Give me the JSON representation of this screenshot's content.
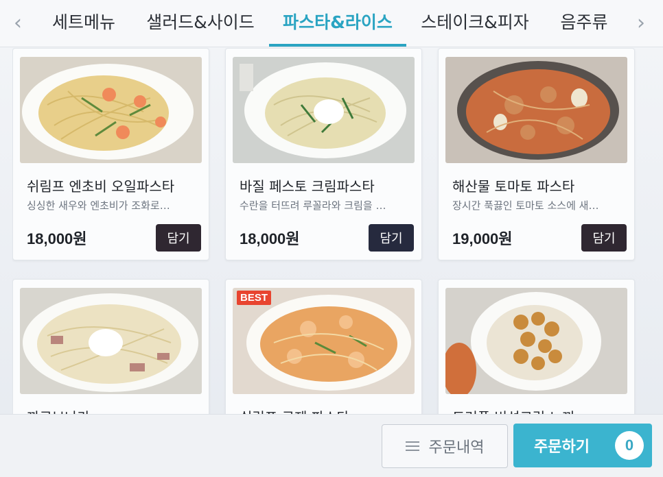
{
  "nav": {
    "prev_icon": "chevron-left-icon",
    "next_icon": "chevron-right-icon",
    "tabs": [
      {
        "label": "세트메뉴"
      },
      {
        "label": "샐러드&사이드"
      },
      {
        "label": "파스타&라이스"
      },
      {
        "label": "스테이크&피자"
      },
      {
        "label": "음주류"
      }
    ],
    "active_tab": "파스타&라이스"
  },
  "menu": {
    "add_label": "담기",
    "items": [
      {
        "name": "쉬림프 엔초비 오일파스타",
        "desc": "싱싱한 새우와 엔초비가 조화로…",
        "price": "18,000원"
      },
      {
        "name": "바질 페스토 크림파스타",
        "desc": "수란을 터뜨려 루꼴라와 크림을 …",
        "price": "18,000원"
      },
      {
        "name": "해산물 토마토 파스타",
        "desc": "장시간 푹끓인 토마토 소스에 새…",
        "price": "19,000원"
      },
      {
        "name": "까르보나라",
        "desc": "",
        "price": "",
        "badge": ""
      },
      {
        "name": "쉬림프 로제 파스타",
        "desc": "",
        "price": "",
        "badge": "BEST"
      },
      {
        "name": "트러플 버섯크림 뇨끼",
        "desc": "",
        "price": "",
        "badge": ""
      }
    ]
  },
  "footer": {
    "history_label": "주문내역",
    "order_label": "주문하기",
    "cart_count": "0"
  },
  "colors": {
    "accent": "#2aa4c2",
    "order_button": "#3bb4cf",
    "add_button": "#2f2731",
    "best_badge": "#e8442f"
  }
}
